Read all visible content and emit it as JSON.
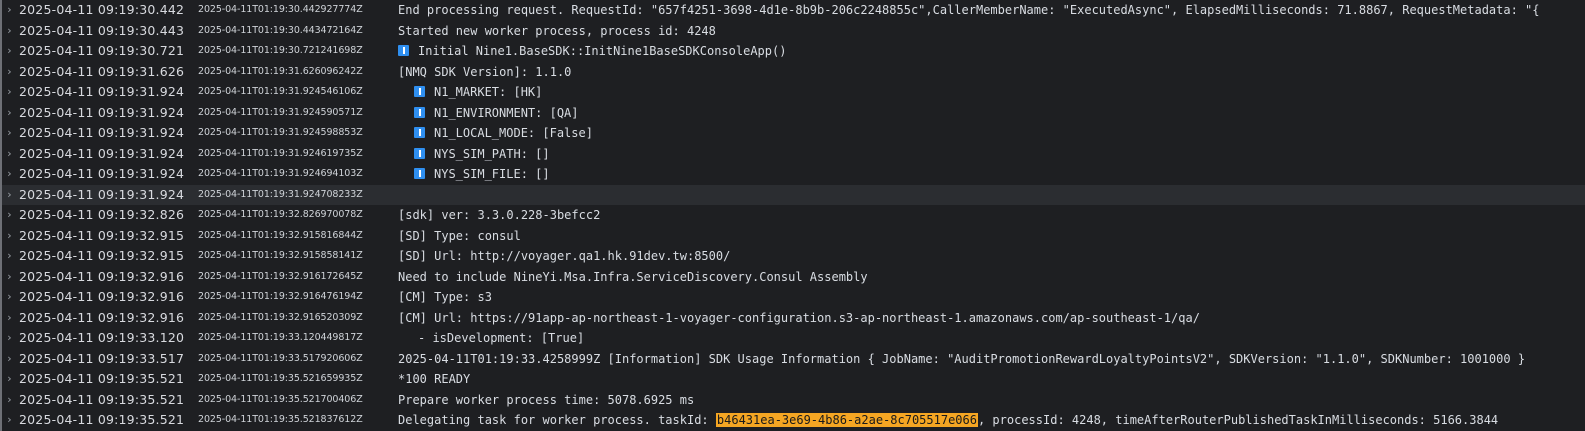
{
  "log": {
    "rows": [
      {
        "ts": "2025-04-11 09:19:30.442",
        "raw": "2025-04-11T01:19:30.442927774Z",
        "msg": "End processing request. RequestId: \"657f4251-3698-4d1e-8b9b-206c2248855c\",CallerMemberName: \"ExecutedAsync\", ElapsedMilliseconds: 71.8867, RequestMetadata: \"{"
      },
      {
        "ts": "2025-04-11 09:19:30.443",
        "raw": "2025-04-11T01:19:30.443472164Z",
        "msg": "Started new worker process, process id: 4248"
      },
      {
        "ts": "2025-04-11 09:19:30.721",
        "raw": "2025-04-11T01:19:30.721241698Z",
        "msg": "Initial Nine1.BaseSDK::InitNine1BaseSDKConsoleApp()",
        "icon": "info-icon"
      },
      {
        "ts": "2025-04-11 09:19:31.626",
        "raw": "2025-04-11T01:19:31.626096242Z",
        "msg": "[NMQ SDK Version]: 1.1.0"
      },
      {
        "ts": "2025-04-11 09:19:31.924",
        "raw": "2025-04-11T01:19:31.924546106Z",
        "msg": "N1_MARKET: [HK]",
        "icon": "info-icon",
        "indent": true
      },
      {
        "ts": "2025-04-11 09:19:31.924",
        "raw": "2025-04-11T01:19:31.924590571Z",
        "msg": "N1_ENVIRONMENT: [QA]",
        "icon": "info-icon",
        "indent": true
      },
      {
        "ts": "2025-04-11 09:19:31.924",
        "raw": "2025-04-11T01:19:31.924598853Z",
        "msg": "N1_LOCAL_MODE: [False]",
        "icon": "info-icon",
        "indent": true
      },
      {
        "ts": "2025-04-11 09:19:31.924",
        "raw": "2025-04-11T01:19:31.924619735Z",
        "msg": "NYS_SIM_PATH: []",
        "icon": "info-icon",
        "indent": true
      },
      {
        "ts": "2025-04-11 09:19:31.924",
        "raw": "2025-04-11T01:19:31.924694103Z",
        "msg": "NYS_SIM_FILE: []",
        "icon": "info-icon",
        "indent": true
      },
      {
        "ts": "2025-04-11 09:19:31.924",
        "raw": "2025-04-11T01:19:31.924708233Z",
        "msg": "",
        "selected": true
      },
      {
        "ts": "2025-04-11 09:19:32.826",
        "raw": "2025-04-11T01:19:32.826970078Z",
        "msg": "[sdk] ver: 3.3.0.228-3befcc2"
      },
      {
        "ts": "2025-04-11 09:19:32.915",
        "raw": "2025-04-11T01:19:32.915816844Z",
        "msg": "[SD] Type: consul"
      },
      {
        "ts": "2025-04-11 09:19:32.915",
        "raw": "2025-04-11T01:19:32.915858141Z",
        "msg": "[SD] Url: http://voyager.qa1.hk.91dev.tw:8500/"
      },
      {
        "ts": "2025-04-11 09:19:32.916",
        "raw": "2025-04-11T01:19:32.916172645Z",
        "msg": "Need to include NineYi.Msa.Infra.ServiceDiscovery.Consul Assembly"
      },
      {
        "ts": "2025-04-11 09:19:32.916",
        "raw": "2025-04-11T01:19:32.916476194Z",
        "msg": "[CM] Type: s3"
      },
      {
        "ts": "2025-04-11 09:19:32.916",
        "raw": "2025-04-11T01:19:32.916520309Z",
        "msg": "[CM] Url: https://91app-ap-northeast-1-voyager-configuration.s3-ap-northeast-1.amazonaws.com/ap-southeast-1/qa/"
      },
      {
        "ts": "2025-04-11 09:19:33.120",
        "raw": "2025-04-11T01:19:33.120449817Z",
        "msg": "- isDevelopment: [True]",
        "indent2": true
      },
      {
        "ts": "2025-04-11 09:19:33.517",
        "raw": "2025-04-11T01:19:33.517920606Z",
        "msg": "2025-04-11T01:19:33.4258999Z [Information] SDK Usage Information { JobName: \"AuditPromotionRewardLoyaltyPointsV2\", SDKVersion: \"1.1.0\", SDKNumber: 1001000 }"
      },
      {
        "ts": "2025-04-11 09:19:35.521",
        "raw": "2025-04-11T01:19:35.521659935Z",
        "msg": "*100 READY"
      },
      {
        "ts": "2025-04-11 09:19:35.521",
        "raw": "2025-04-11T01:19:35.521700406Z",
        "msg": "Prepare worker process time: 5078.6925 ms"
      },
      {
        "ts": "2025-04-11 09:19:35.521",
        "raw": "2025-04-11T01:19:35.521837612Z",
        "msg_pre": "Delegating task for worker process.  taskId: ",
        "msg_hl": "b46431ea-3e69-4b86-a2ae-8c705517e066",
        "msg_post": ", processId: 4248, timeAfterRouterPublishedTaskInMilliseconds: 5166.3844"
      }
    ],
    "colors": {
      "background": "#1e1f22",
      "selected_row": "#2b2d31",
      "info_icon": "#2f8ff0",
      "highlight": "#f5a623"
    }
  }
}
